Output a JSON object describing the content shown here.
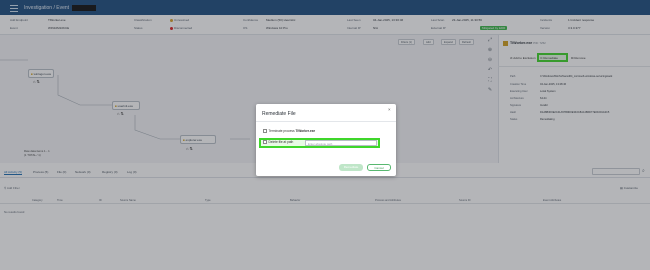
{
  "header": {
    "title": "Investigation / Event"
  },
  "meta": {
    "c1": [
      "Add Endpoint",
      "Event"
    ],
    "c2": [
      "TiWorker.exe",
      "WIN10M10KCE"
    ],
    "c3": [
      "Classification",
      "Status"
    ],
    "c4": [
      "Unresolved",
      "Disconnected"
    ],
    "c5": [
      "Confidence",
      "OS"
    ],
    "c6": [
      "Medium (50) Heuristic",
      "Windows 10 Pro"
    ],
    "c7": [
      "Last Seen",
      "Internal IP"
    ],
    "c8": [
      "04-Jan-2025, 13:30:46",
      "N/A"
    ],
    "c9": [
      "Last Scan",
      "External IP"
    ],
    "c10": [
      "23-Jan-2025, 11:30:56",
      "External IP"
    ],
    "c11": [
      "Incidents",
      "Version"
    ],
    "c12": [
      "1 Incident response",
      "3.3.0.377"
    ],
    "tag": "Mitigated by EDR"
  },
  "graph": {
    "nodes": [
      "winlogon.exe",
      "userinit.exe",
      "explorer.exe"
    ],
    "filters": [
      "Filters (1)",
      "Add",
      "Expand",
      "Refresh"
    ],
    "raw_info": [
      "Raw data items 1 - 1",
      "(1 TOTAL / 1)"
    ],
    "tools": [
      "⤢",
      "⊕",
      "⊖",
      "↶",
      "⛶",
      "✎"
    ]
  },
  "panel": {
    "title": "TiWorker.exe",
    "title_suffix": "PID: 7252",
    "add_exclusion": "Add to Exclusion",
    "remediate": "Remediate",
    "remove": "Remove",
    "rows": [
      [
        "Path",
        "C:\\Windows\\WinSxS\\amd64_microsoft-windows-servicingstack"
      ],
      [
        "Creation Time",
        "04-Jan-2025, 13:28:46"
      ],
      [
        "Executing User",
        "Local System"
      ],
      [
        "Architecture",
        "64-bit"
      ],
      [
        "Signature",
        "Invalid"
      ],
      [
        "Hash",
        "D1A8B3F0E2C41A57B9D0E3F2C8A14B6D77E0F291A3C5"
      ],
      [
        "Status",
        "Remediating"
      ]
    ]
  },
  "tabs": [
    "All Activity (5)",
    "Process (5)",
    "File (0)",
    "Network (0)",
    "Registry (0)",
    "Log (0)"
  ],
  "table": {
    "filter_label": "Add Filter",
    "customize": "Customize",
    "columns": [
      "Category",
      "Time",
      "ID",
      "Source Name",
      "Type",
      "Behavior",
      "Process and Attributes",
      "Source ID",
      "Event Attributes"
    ],
    "empty": "No results found"
  },
  "modal": {
    "title": "Remediate File",
    "opt1": "Terminate process",
    "opt1_proc": "TiWorker.exe",
    "opt2": "Delete file at path",
    "path_placeholder": "Enter absolute path",
    "remediate_btn": "Remediate",
    "cancel_btn": "Cancel",
    "accent": "#3fd62a"
  }
}
